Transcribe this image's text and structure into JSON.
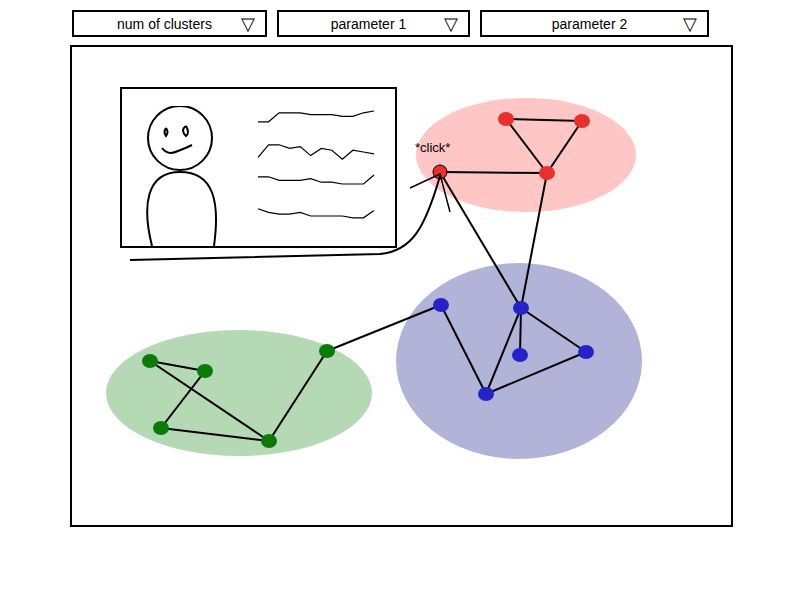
{
  "toolbar": {
    "dropdowns": [
      {
        "label": "num of clusters",
        "arrow": "▽"
      },
      {
        "label": "parameter 1",
        "arrow": "▽"
      },
      {
        "label": "parameter 2",
        "arrow": "▽"
      }
    ]
  },
  "graph": {
    "click_label": "*click*",
    "clusters": [
      {
        "color": "#e8302f",
        "fill": "#ffc6c6",
        "nodes": [
          {
            "selected": false
          },
          {
            "selected": false
          },
          {
            "selected": false
          },
          {
            "selected": true
          }
        ]
      },
      {
        "color": "#2323c8",
        "fill": "#b1b4d8",
        "nodes": [
          {
            "selected": false
          },
          {
            "selected": false
          },
          {
            "selected": false
          },
          {
            "selected": false
          },
          {
            "selected": false
          }
        ]
      },
      {
        "color": "#0b7a0b",
        "fill": "#b5d8b5",
        "nodes": [
          {
            "selected": false
          },
          {
            "selected": false
          },
          {
            "selected": false
          },
          {
            "selected": false
          },
          {
            "selected": false
          }
        ]
      }
    ]
  },
  "popup": {
    "open": true,
    "waveforms": [
      [
        3,
        3,
        8,
        8,
        8,
        7,
        7,
        7,
        6,
        6,
        8,
        9
      ],
      [
        1,
        8,
        8,
        6,
        7,
        2,
        6,
        5,
        0,
        5,
        4,
        3
      ],
      [
        8,
        8,
        6,
        6,
        6,
        7,
        5,
        5,
        4,
        4,
        4,
        9
      ],
      [
        8,
        6,
        5,
        5,
        6,
        4,
        4,
        4,
        4,
        3,
        3,
        7
      ]
    ]
  }
}
